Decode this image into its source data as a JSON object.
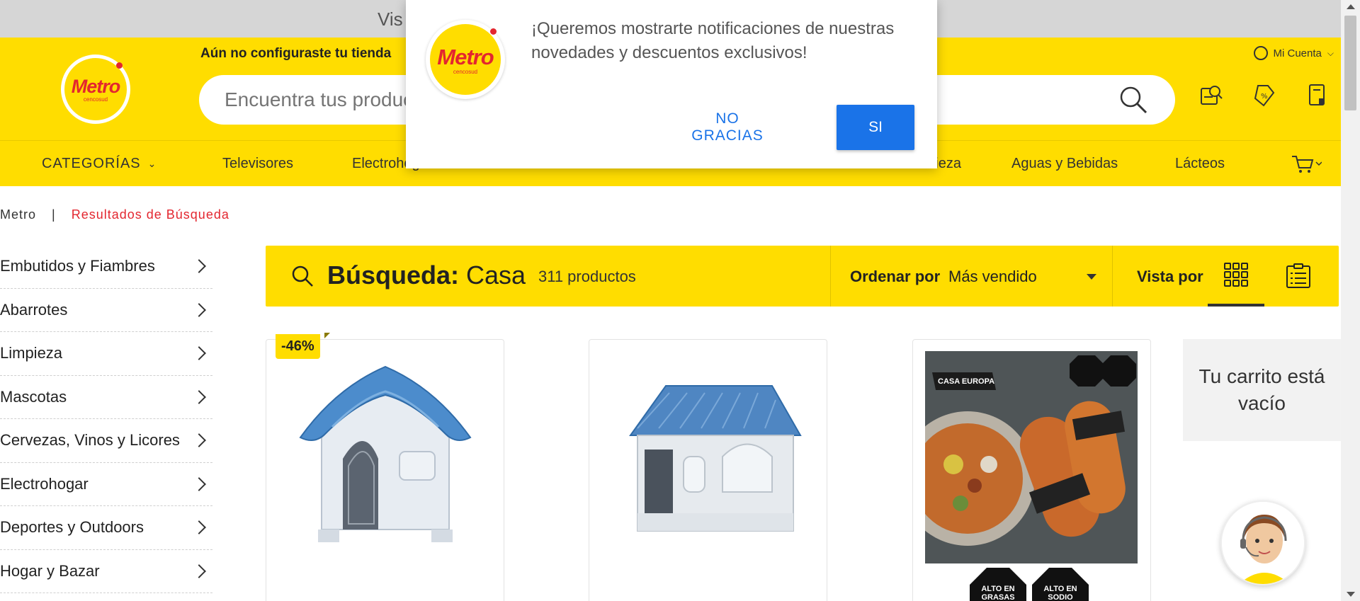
{
  "promo": {
    "text": "Vis"
  },
  "header": {
    "logo_text": "Metro",
    "logo_sub": "cencosud",
    "store_notice": "Aún no configuraste tu tienda",
    "account_label": "Mi Cuenta",
    "search_placeholder": "Encuentra tus productos",
    "icons": [
      "store-locator-icon",
      "coupons-icon",
      "orders-icon"
    ]
  },
  "nav": {
    "categories_label": "CATEGORÍAS",
    "items": [
      "Televisores",
      "Electrohogar",
      "Limpieza",
      "Aguas y Bebidas",
      "Lácteos"
    ]
  },
  "breadcrumb": {
    "home": "Metro",
    "separator": "|",
    "current": "Resultados de Búsqueda"
  },
  "sidebar": {
    "items": [
      "Embutidos y Fiambres",
      "Abarrotes",
      "Limpieza",
      "Mascotas",
      "Cervezas, Vinos y Licores",
      "Electrohogar",
      "Deportes y Outdoors",
      "Hogar y Bazar"
    ]
  },
  "results": {
    "search_label": "Búsqueda:",
    "query": "Casa",
    "count": "311 productos",
    "order_label": "Ordenar por",
    "order_value": "Más vendido",
    "view_label": "Vista por"
  },
  "products": [
    {
      "badge": "-46%",
      "image": "blue-dog-house-small"
    },
    {
      "badge": "",
      "image": "blue-dog-house-large"
    },
    {
      "badge": "",
      "image": "casa-europa-sausages",
      "brand": "CASA EUROPA",
      "seals": [
        "ALTO EN GRASAS",
        "ALTO EN SODIO"
      ]
    }
  ],
  "cart": {
    "empty_text": "Tu carrito está vacío"
  },
  "popup": {
    "message": "¡Queremos mostrarte notificaciones de nuestras novedades y descuentos exclusivos!",
    "no_label": "NO GRACIAS",
    "yes_label": "SI"
  },
  "colors": {
    "brand_yellow": "#ffdd00",
    "brand_red": "#e3262f",
    "button_blue": "#1a73e8"
  }
}
